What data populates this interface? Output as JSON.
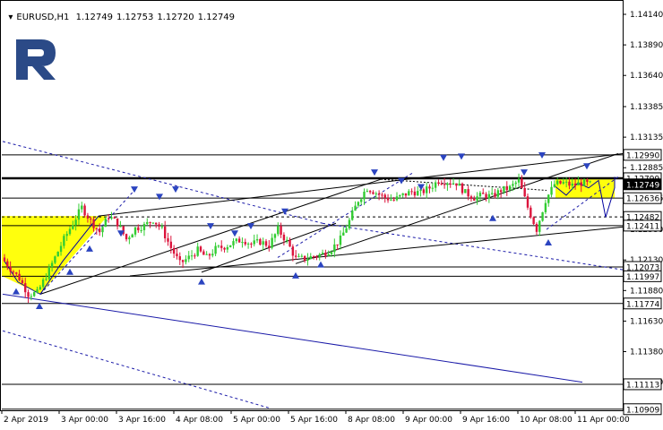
{
  "header": {
    "dropdown_icon": "triangle-down-icon",
    "symbol": "EURUSD,H1",
    "open": "1.12749",
    "high": "1.12753",
    "low": "1.12720",
    "close": "1.12749"
  },
  "logo": {
    "name": "roboforex-logo-icon",
    "color": "#2b4a87"
  },
  "colors": {
    "candle_up": "#32cd32",
    "candle_down": "#dc143c",
    "trendline": "#000000",
    "channel_blue": "#0000a0",
    "forecast_fill": "#ffff00",
    "pattern_blue": "#2b44c0"
  },
  "chart_data": {
    "type": "candlestick",
    "symbol": "EURUSD",
    "timeframe": "H1",
    "ylim": [
      1.109,
      1.1425
    ],
    "x_ticks": [
      "2 Apr 2019",
      "3 Apr 00:00",
      "3 Apr 16:00",
      "4 Apr 08:00",
      "5 Apr 00:00",
      "5 Apr 16:00",
      "8 Apr 08:00",
      "9 Apr 00:00",
      "9 Apr 16:00",
      "10 Apr 08:00",
      "11 Apr 00:00"
    ],
    "y_ticks": [
      "1.14140",
      "1.13890",
      "1.13640",
      "1.13385",
      "1.13135",
      "1.12885",
      "1.12636",
      "1.12380",
      "1.12130",
      "1.11880",
      "1.11630",
      "1.11380",
      "1.11130"
    ],
    "price_tags": [
      {
        "text": "1.12990",
        "value": 1.1299,
        "style": "outline"
      },
      {
        "text": "1.12799",
        "value": 1.12799,
        "style": "outline"
      },
      {
        "text": "1.12749",
        "value": 1.12749,
        "style": "filled"
      },
      {
        "text": "1.12636",
        "value": 1.12636,
        "style": "outline"
      },
      {
        "text": "1.12482",
        "value": 1.12482,
        "style": "outline"
      },
      {
        "text": "1.12411",
        "value": 1.12411,
        "style": "outline"
      },
      {
        "text": "1.12073",
        "value": 1.12073,
        "style": "outline"
      },
      {
        "text": "1.11997",
        "value": 1.11997,
        "style": "outline"
      },
      {
        "text": "1.11774",
        "value": 1.11774,
        "style": "outline"
      },
      {
        "text": "1.11113",
        "value": 1.11113,
        "style": "outline"
      },
      {
        "text": "1.10909",
        "value": 1.10909,
        "style": "outline"
      }
    ],
    "horizontal_levels": [
      1.1299,
      1.12799,
      1.12636,
      1.12482,
      1.12411,
      1.12073,
      1.11997,
      1.11774,
      1.11113,
      1.10909
    ],
    "candle_path": [
      1.1215,
      1.1206,
      1.1198,
      1.1185,
      1.1186,
      1.12,
      1.1215,
      1.123,
      1.1243,
      1.1256,
      1.1245,
      1.1236,
      1.1249,
      1.1243,
      1.123,
      1.1239,
      1.1241,
      1.1246,
      1.1238,
      1.1223,
      1.121,
      1.1215,
      1.1221,
      1.1215,
      1.1222,
      1.1224,
      1.1227,
      1.123,
      1.1226,
      1.1228,
      1.1225,
      1.1238,
      1.1228,
      1.1214,
      1.1214,
      1.1216,
      1.1218,
      1.1222,
      1.123,
      1.1245,
      1.1262,
      1.1272,
      1.1268,
      1.1264,
      1.1262,
      1.1266,
      1.1269,
      1.1268,
      1.1272,
      1.1278,
      1.1277,
      1.1276,
      1.1268,
      1.1264,
      1.1266,
      1.1265,
      1.127,
      1.1272,
      1.1278,
      1.1256,
      1.1238,
      1.1262,
      1.1275,
      1.1276,
      1.1274,
      1.1276,
      1.12749
    ]
  }
}
